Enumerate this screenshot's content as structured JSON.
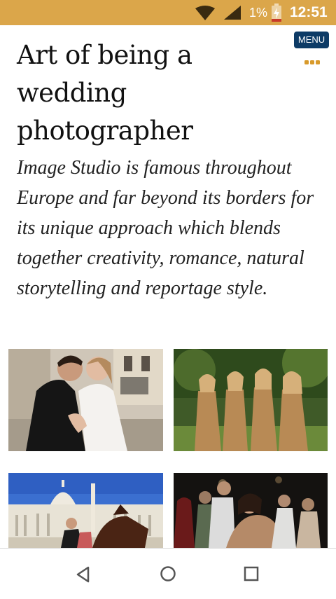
{
  "status_bar": {
    "battery_percent": "1%",
    "time": "12:51",
    "icons": [
      "wifi-icon",
      "signal-icon",
      "battery-charging-icon"
    ]
  },
  "header": {
    "menu_label": "MENU",
    "more_icon": "three-dots-icon"
  },
  "main": {
    "title": "Art of being a wedding photographer",
    "intro": "Image Studio is famous throughout Europe and far beyond its borders for its unique approach which blends together creativity, romance, natural storytelling and reportage style."
  },
  "gallery": {
    "photos": [
      "couple-embrace-photo",
      "bridesmaids-photo",
      "vatican-horse-photo",
      "party-dance-photo"
    ]
  },
  "nav_bar": {
    "icons": [
      "back-icon",
      "home-icon",
      "recents-icon"
    ]
  },
  "colors": {
    "status_bar": "#dba64a",
    "menu_button": "#0d3b66",
    "menu_dots": "#d89a2b"
  }
}
